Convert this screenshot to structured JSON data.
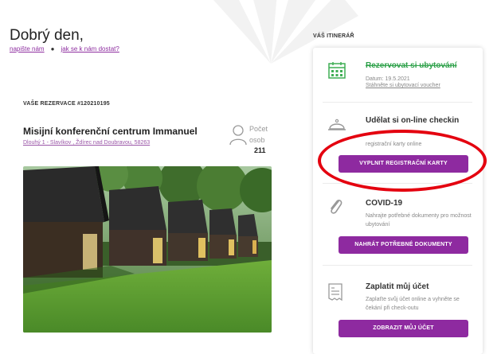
{
  "greeting": {
    "title": "Dobrý den,",
    "write_us": "napište nám",
    "how_to_get": "jak se k nám dostat?"
  },
  "reservation": {
    "label": "VAŠE REZERVACE #120210195",
    "hotel_name": "Misijní konferenční centrum Immanuel",
    "address": "Dlouhý 1 - Slavíkov , Ždírec nad Doubravou, 58263",
    "guests_label": "Počet osob",
    "guests_count": "211"
  },
  "itinerary": {
    "label": "VÁŠ ITINERÁŘ",
    "steps": [
      {
        "title": "Rezervovat si ubytování",
        "date": "Datum: 19.5.2021",
        "link": "Stáhněte si ubytovací voucher",
        "icon": "calendar-icon",
        "status": "done"
      },
      {
        "title": "Udělat si on-line checkin",
        "text": "registrační karty online",
        "button": "VYPLNIT REGISTRAČNÍ KARTY",
        "icon": "bell-icon"
      },
      {
        "title": "COVID-19",
        "text": "Nahrajte potřebné dokumenty pro možnost ubytování",
        "button": "NAHRÁT POTŘEBNÉ DOKUMENTY",
        "icon": "paperclip-icon"
      },
      {
        "title": "Zaplatit můj účet",
        "text": "Zaplaťte svůj účet online a vyhněte se čekání při check-outu",
        "button": "ZOBRAZIT MŮJ ÚČET",
        "icon": "receipt-icon"
      }
    ]
  },
  "colors": {
    "accent": "#8e2aa0",
    "done": "#2ea14a",
    "highlight": "#e4000f"
  }
}
